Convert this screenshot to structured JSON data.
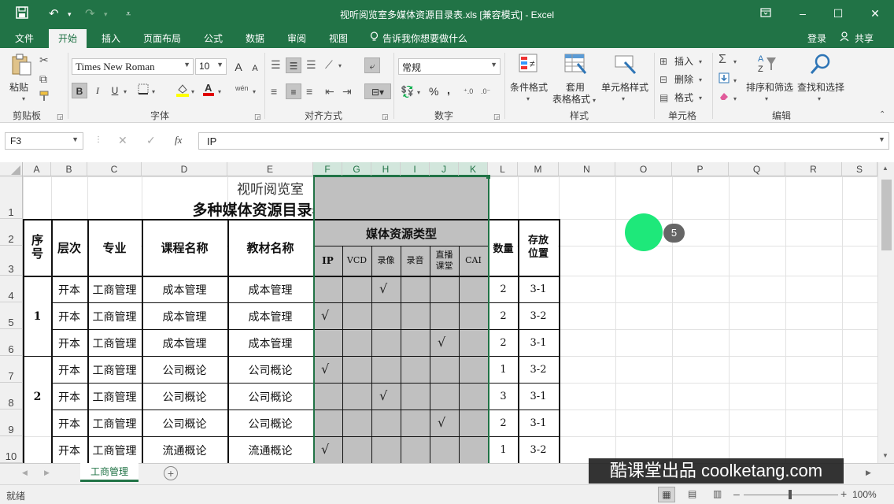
{
  "titlebar": {
    "title": "视听阅览室多媒体资源目录表.xls  [兼容模式] - Excel",
    "icons": [
      "save-icon",
      "undo-icon",
      "redo-icon",
      "customize-icon",
      "ribbon-display-icon",
      "minimize-icon",
      "maximize-icon",
      "close-icon"
    ]
  },
  "menubar": {
    "tabs": [
      "文件",
      "开始",
      "插入",
      "页面布局",
      "公式",
      "数据",
      "审阅",
      "视图"
    ],
    "active": "开始",
    "tell_me": "告诉我你想要做什么",
    "login": "登录",
    "share": "共享"
  },
  "ribbon": {
    "clipboard": {
      "paste": "粘贴",
      "label": "剪贴板"
    },
    "font": {
      "name": "Times New Roman",
      "size": "10",
      "bold": "B",
      "italic": "I",
      "underline": "U",
      "label": "字体",
      "grow": "A",
      "shrink": "A",
      "phonetic": "wén"
    },
    "alignment": {
      "label": "对齐方式"
    },
    "number": {
      "format": "常规",
      "percent": "%",
      "comma": ",",
      "label": "数字"
    },
    "styles": {
      "conditional": "条件格式",
      "table_fmt_1": "套用",
      "table_fmt_2": "表格格式",
      "cell_styles": "单元格样式",
      "label": "样式"
    },
    "cells": {
      "insert": "插入",
      "delete": "删除",
      "format": "格式",
      "label": "单元格"
    },
    "editing": {
      "sort_filter": "排序和筛选",
      "find_select": "查找和选择",
      "label": "编辑"
    }
  },
  "formula_bar": {
    "namebox": "F3",
    "fx": "fx",
    "content": "IP"
  },
  "columns": [
    "A",
    "B",
    "C",
    "D",
    "E",
    "F",
    "G",
    "H",
    "I",
    "J",
    "K",
    "L",
    "M",
    "N",
    "O",
    "P",
    "Q",
    "R",
    "S"
  ],
  "rows": [
    "1",
    "2",
    "3",
    "4",
    "5",
    "6",
    "7",
    "8",
    "9",
    "10"
  ],
  "sheet": {
    "title1": "视听阅览室",
    "title2": "多种媒体资源目录表",
    "headers": {
      "seq": "序\n号",
      "level": "层次",
      "major": "专业",
      "course": "课程名称",
      "textbook": "教材名称",
      "media_type": "媒体资源类型",
      "qty": "数量",
      "location": "存放\n位置"
    },
    "media_headers": [
      "IP",
      "VCD",
      "录像",
      "录音",
      "直播\n课堂",
      "CAI"
    ],
    "groups": [
      "1",
      "2"
    ],
    "data": [
      {
        "level": "开本",
        "major": "工商管理",
        "course": "成本管理",
        "textbook": "成本管理",
        "media": [
          false,
          false,
          true,
          false,
          false,
          false
        ],
        "qty": "2",
        "location": "3-1"
      },
      {
        "level": "开本",
        "major": "工商管理",
        "course": "成本管理",
        "textbook": "成本管理",
        "media": [
          true,
          false,
          false,
          false,
          false,
          false
        ],
        "qty": "2",
        "location": "3-2"
      },
      {
        "level": "开本",
        "major": "工商管理",
        "course": "成本管理",
        "textbook": "成本管理",
        "media": [
          false,
          false,
          false,
          false,
          true,
          false
        ],
        "qty": "2",
        "location": "3-1"
      },
      {
        "level": "开本",
        "major": "工商管理",
        "course": "公司概论",
        "textbook": "公司概论",
        "media": [
          true,
          false,
          false,
          false,
          false,
          false
        ],
        "qty": "1",
        "location": "3-2"
      },
      {
        "level": "开本",
        "major": "工商管理",
        "course": "公司概论",
        "textbook": "公司概论",
        "media": [
          false,
          false,
          true,
          false,
          false,
          false
        ],
        "qty": "3",
        "location": "3-1"
      },
      {
        "level": "开本",
        "major": "工商管理",
        "course": "公司概论",
        "textbook": "公司概论",
        "media": [
          false,
          false,
          false,
          false,
          true,
          false
        ],
        "qty": "2",
        "location": "3-1"
      },
      {
        "level": "开本",
        "major": "工商管理",
        "course": "流通概论",
        "textbook": "流通概论",
        "media": [
          true,
          false,
          false,
          false,
          false,
          false
        ],
        "qty": "1",
        "location": "3-2"
      }
    ],
    "check_mark": "√"
  },
  "sheet_tabs": [
    "工商管理"
  ],
  "status": {
    "ready": "就绪",
    "zoom": "100%"
  },
  "overlay": {
    "click_step": "5",
    "watermark": "酷课堂出品 coolketang.com"
  },
  "colors": {
    "excel_green": "#217346",
    "selection_gray": "#c0c0c0"
  }
}
